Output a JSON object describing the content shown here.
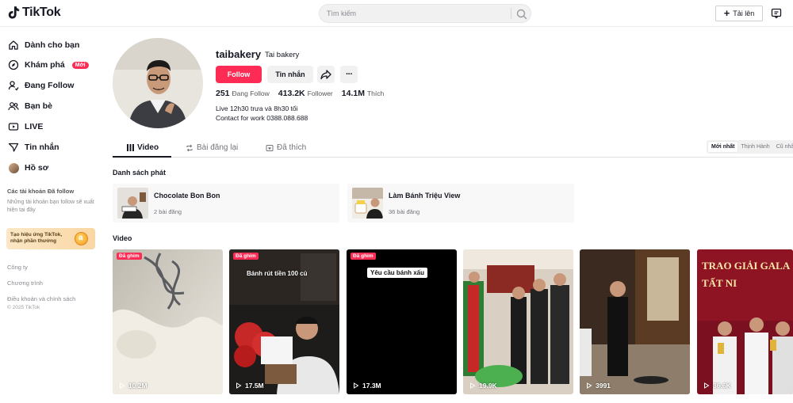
{
  "header": {
    "logo_text": "TikTok",
    "search_placeholder": "Tìm kiếm",
    "upload_label": "Tải lên"
  },
  "sidebar": {
    "items": [
      {
        "label": "Dành cho bạn",
        "icon": "home-icon"
      },
      {
        "label": "Khám phá",
        "icon": "compass-icon",
        "badge": "Mới"
      },
      {
        "label": "Đang Follow",
        "icon": "user-follow-icon"
      },
      {
        "label": "Bạn bè",
        "icon": "friends-icon"
      },
      {
        "label": "LIVE",
        "icon": "live-icon"
      },
      {
        "label": "Tin nhắn",
        "icon": "message-icon"
      },
      {
        "label": "Hồ sơ",
        "icon": "profile-avatar"
      }
    ],
    "following_title": "Các tài khoản Đã follow",
    "following_desc": "Những tài khoản bạn follow sẽ xuất hiện tại đây",
    "promo_text": "Tạo hiệu ứng TikTok, nhận phần thưởng",
    "footer_links": [
      "Công ty",
      "Chương trình",
      "Điều khoản và chính sách"
    ],
    "copyright": "© 2025 TikTok"
  },
  "profile": {
    "username": "taibakery",
    "nickname": "Tai bakery",
    "follow_label": "Follow",
    "message_label": "Tin nhắn",
    "more_label": "···",
    "following_count": "251",
    "following_label": "Đang Follow",
    "followers_count": "413.2K",
    "followers_label": "Follower",
    "likes_count": "14.1M",
    "likes_label": "Thích",
    "bio_line1": "Live 12h30 trưa và 8h30 tối",
    "bio_line2": "Contact for work 0388.088.688"
  },
  "tabs": {
    "video": "Video",
    "reposts": "Bài đăng lại",
    "liked": "Đã thích",
    "sort": [
      "Mới nhất",
      "Thịnh Hành",
      "Cũ nhất"
    ]
  },
  "playlists": {
    "title": "Danh sách phát",
    "items": [
      {
        "name": "Chocolate Bon Bon",
        "count": "2 bài đăng"
      },
      {
        "name": "Làm Bánh Triệu View",
        "count": "36 bài đăng"
      }
    ]
  },
  "videos": {
    "title": "Video",
    "pin_label": "Đã ghim",
    "items": [
      {
        "views": "10.2M",
        "pinned": true,
        "caption": ""
      },
      {
        "views": "17.5M",
        "pinned": true,
        "caption": "Bánh rút tiền 100 củ"
      },
      {
        "views": "17.3M",
        "pinned": true,
        "caption": "Yêu cầu bánh xấu"
      },
      {
        "views": "19.9K",
        "pinned": false,
        "caption": ""
      },
      {
        "views": "3991",
        "pinned": false,
        "caption": ""
      },
      {
        "views": "36.6K",
        "pinned": false,
        "caption": "TRAO GIẢI GALA TẤT NI"
      }
    ]
  },
  "colors": {
    "accent": "#fe2c55",
    "text": "#161823",
    "muted": "#73747b"
  }
}
